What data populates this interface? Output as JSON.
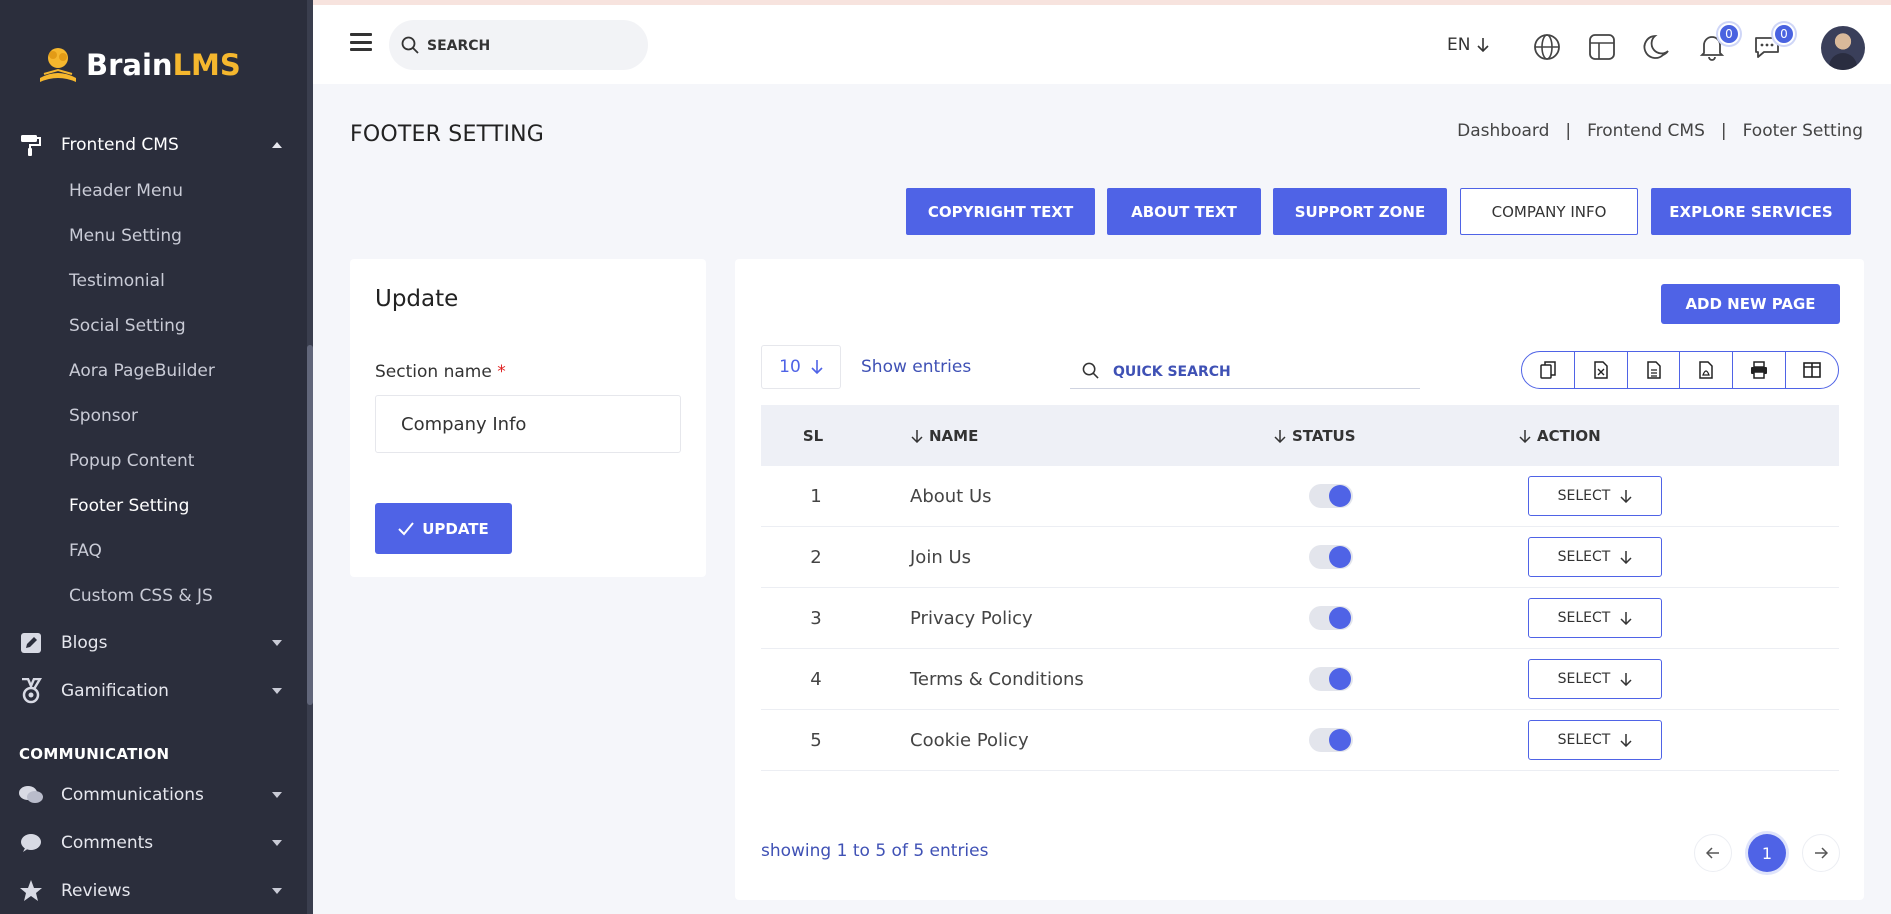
{
  "brand": {
    "part1": "Brain",
    "part2": "LMS"
  },
  "sidebar": {
    "active_parent": {
      "label": "Frontend CMS",
      "icon": "paint-roller-icon"
    },
    "children": [
      {
        "label": "Header Menu"
      },
      {
        "label": "Menu Setting"
      },
      {
        "label": "Testimonial"
      },
      {
        "label": "Social Setting"
      },
      {
        "label": "Aora PageBuilder"
      },
      {
        "label": "Sponsor"
      },
      {
        "label": "Popup Content"
      },
      {
        "label": "Footer Setting"
      },
      {
        "label": "FAQ"
      },
      {
        "label": "Custom CSS & JS"
      }
    ],
    "blogs": {
      "label": "Blogs",
      "icon": "edit-icon"
    },
    "gamification": {
      "label": "Gamification",
      "icon": "medal-icon"
    },
    "section_title": "COMMUNICATION",
    "communications": {
      "label": "Communications",
      "icon": "chat-bubbles-icon"
    },
    "comments": {
      "label": "Comments",
      "icon": "comment-icon"
    },
    "reviews": {
      "label": "Reviews",
      "icon": "star-icon"
    }
  },
  "topbar": {
    "search_placeholder": "SEARCH",
    "language": "EN",
    "notifications_count": "0",
    "messages_count": "0"
  },
  "page": {
    "title": "FOOTER SETTING",
    "breadcrumb": [
      "Dashboard",
      "Frontend CMS",
      "Footer Setting"
    ],
    "tabs": [
      {
        "label": "COPYRIGHT TEXT"
      },
      {
        "label": "ABOUT TEXT"
      },
      {
        "label": "SUPPORT ZONE"
      },
      {
        "label": "COMPANY INFO"
      },
      {
        "label": "EXPLORE SERVICES"
      }
    ]
  },
  "update_form": {
    "title": "Update",
    "section_label": "Section name",
    "required_mark": "*",
    "section_value": "Company Info",
    "update_label": "UPDATE"
  },
  "table": {
    "add_new_label": "ADD NEW PAGE",
    "entries_value": "10",
    "show_entries_label": "Show entries",
    "quick_search_placeholder": "QUICK SEARCH",
    "columns": {
      "sl": "SL",
      "name": "NAME",
      "status": "STATUS",
      "action": "ACTION"
    },
    "rows": [
      {
        "sl": "1",
        "name": "About Us",
        "status_on": true,
        "action": "SELECT"
      },
      {
        "sl": "2",
        "name": "Join Us",
        "status_on": true,
        "action": "SELECT"
      },
      {
        "sl": "3",
        "name": "Privacy Policy",
        "status_on": true,
        "action": "SELECT"
      },
      {
        "sl": "4",
        "name": "Terms & Conditions",
        "status_on": true,
        "action": "SELECT"
      },
      {
        "sl": "5",
        "name": "Cookie Policy",
        "status_on": true,
        "action": "SELECT"
      }
    ],
    "showing_text": "showing 1 to 5 of 5 entries",
    "current_page": "1"
  },
  "colors": {
    "primary": "#4f63e6",
    "sidebar": "#2b2e3c",
    "brand_accent": "#f5b72e"
  }
}
